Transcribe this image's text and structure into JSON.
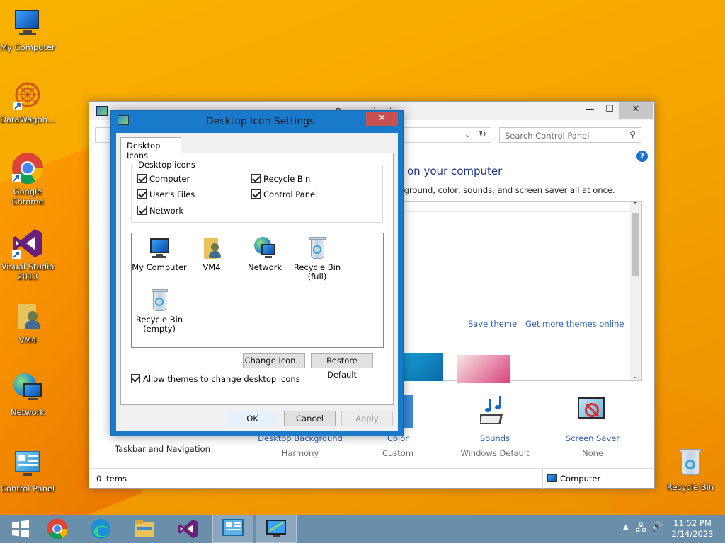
{
  "desktop": {
    "icons": [
      {
        "label": "My Computer"
      },
      {
        "label": "DataWagon..."
      },
      {
        "label": "Google Chrome"
      },
      {
        "label": "Visual Studio 2013"
      },
      {
        "label": "VM4"
      },
      {
        "label": "Network"
      },
      {
        "label": "Control Panel"
      },
      {
        "label": "Recycle Bin"
      }
    ]
  },
  "control_panel": {
    "title": "Personalization",
    "search_placeholder": "Search Control Panel",
    "heading": "on your computer",
    "subheading": "kground, color, sounds, and screen saver all at once.",
    "save_theme": "Save theme",
    "more_themes": "Get more themes online",
    "taskbar_nav": "Taskbar and Navigation",
    "bottom": [
      {
        "title": "Desktop Background",
        "value": "Harmony"
      },
      {
        "title": "Color",
        "value": "Custom"
      },
      {
        "title": "Sounds",
        "value": "Windows Default"
      },
      {
        "title": "Screen Saver",
        "value": "None"
      }
    ],
    "status_items": "0 items",
    "status_zone": "Computer"
  },
  "dialog": {
    "title": "Desktop Icon Settings",
    "close": "✕",
    "tab": "Desktop Icons",
    "group_title": "Desktop icons",
    "checkboxes": [
      {
        "label": "Computer",
        "checked": true
      },
      {
        "label": "Recycle Bin",
        "checked": true
      },
      {
        "label": "User's Files",
        "checked": true
      },
      {
        "label": "Control Panel",
        "checked": true
      },
      {
        "label": "Network",
        "checked": true
      }
    ],
    "icons": [
      {
        "label": "My Computer"
      },
      {
        "label": "VM4"
      },
      {
        "label": "Network"
      },
      {
        "label": "Recycle Bin\n(full)",
        "line1": "Recycle Bin",
        "line2": "(full)"
      },
      {
        "label": "Recycle Bin (empty)",
        "line1": "Recycle Bin",
        "line2": "(empty)"
      }
    ],
    "change_icon": "Change Icon...",
    "restore_default": "Restore Default",
    "allow_themes": "Allow themes to change desktop icons",
    "ok": "OK",
    "cancel": "Cancel",
    "apply": "Apply"
  },
  "taskbar": {
    "time": "11:52 PM",
    "date": "2/14/2023"
  },
  "colors": {
    "desktop": "#f5a800",
    "dialog_frame": "#1979ca",
    "taskbar": "#6a8fab",
    "link": "#2f5fb3"
  }
}
